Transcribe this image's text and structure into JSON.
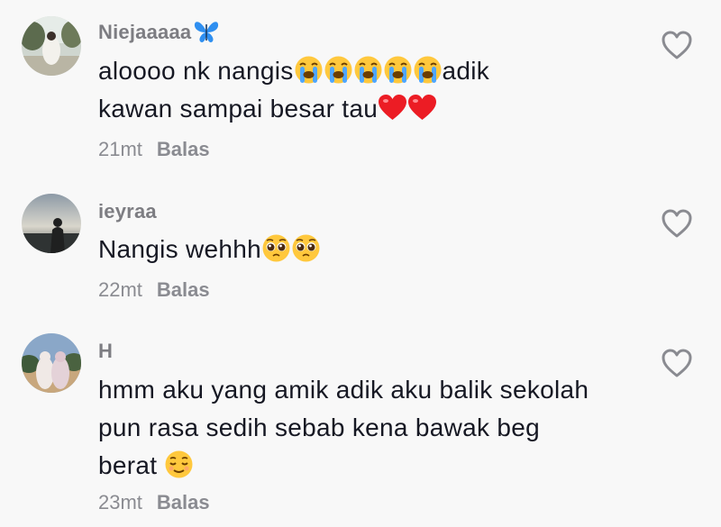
{
  "comments": [
    {
      "username": "Niejaaaaa",
      "username_emoji": "butterfly-emoji",
      "text_parts": [
        "aloooo nk nangis",
        "adik",
        "kawan sampai besar tau"
      ],
      "emojis": [
        "loudly-crying-face",
        "loudly-crying-face",
        "loudly-crying-face",
        "loudly-crying-face",
        "loudly-crying-face",
        "red-heart",
        "red-heart"
      ],
      "time": "21mt",
      "reply_label": "Balas",
      "like_icon": "heart-outline-icon"
    },
    {
      "username": "ieyraa",
      "text_parts": [
        "Nangis wehhh"
      ],
      "emojis": [
        "pleading-face",
        "pleading-face"
      ],
      "time": "22mt",
      "reply_label": "Balas",
      "like_icon": "heart-outline-icon"
    },
    {
      "username": "H",
      "text_parts": [
        "hmm aku yang amik adik aku balik sekolah",
        "pun rasa sedih sebab kena bawak beg",
        "berat"
      ],
      "emojis": [
        "relieved-face"
      ],
      "time": "23mt",
      "reply_label": "Balas",
      "like_icon": "heart-outline-icon"
    }
  ],
  "colors": {
    "background": "#f8f8f8",
    "text": "#161823",
    "secondary": "#8a8b91"
  }
}
